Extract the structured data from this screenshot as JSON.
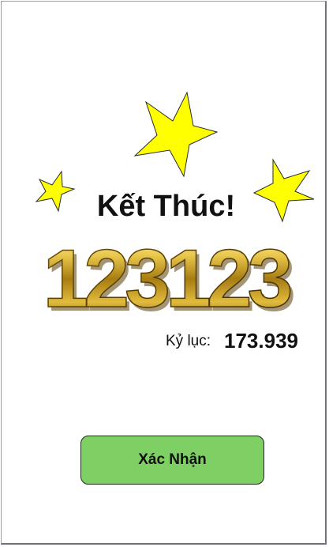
{
  "title": "Kết Thúc!",
  "score": "123123",
  "record": {
    "label": "Kỷ lục:",
    "value": "173.939"
  },
  "confirm_button": "Xác Nhận",
  "colors": {
    "star": "#ffff00",
    "button": "#7ed064",
    "score_gold": "#d4af37"
  }
}
